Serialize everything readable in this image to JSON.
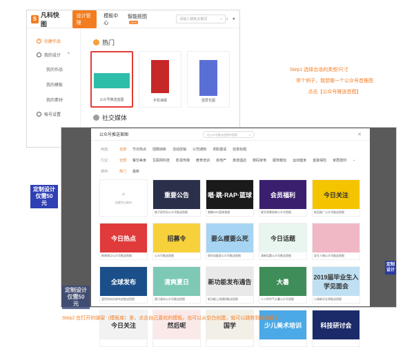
{
  "app": {
    "logo_text": "凡科快图",
    "nav": [
      "设计管理",
      "模板中心",
      "智能抠图"
    ],
    "nav_badge": "NEW",
    "search_placeholder": "请输入模板关键词"
  },
  "sidebar": {
    "create": "创建作品",
    "my_design": "我的设计",
    "items": [
      "我的作品",
      "我的模板",
      "我的素材"
    ],
    "account": "帐号设置"
  },
  "content": {
    "hot_title": "热门",
    "social_title": "社交媒体",
    "templates": [
      "公众号推送首图",
      "手机海报",
      "竖屏长图"
    ]
  },
  "step1": {
    "line1": "Step1 选择合适的类型/尺寸",
    "line2": "举个例子，我想做一个公众号首推图",
    "line3": "点击【公众号推送首图】"
  },
  "modal": {
    "title": "公众号推送首图",
    "search_placeholder": "在公众号推送首图中搜索",
    "filters": [
      {
        "label": "用途：",
        "options": [
          "全部",
          "节日热点",
          "招聘纳新",
          "活动促销",
          "公司通知",
          "求职邀请",
          "创意标题"
        ]
      },
      {
        "label": "行业：",
        "options": [
          "全部",
          "餐饮美食",
          "互联网科技",
          "影视传媒",
          "教育培训",
          "房地产",
          "旅游酒店",
          "数码家电",
          "服饰箱包",
          "运动健身",
          "金融保险",
          "家居建材"
        ]
      },
      {
        "label": "排序：",
        "options": [
          "热门",
          "最新"
        ]
      }
    ],
    "blank_label": "创建空白画布",
    "cards": [
      {
        "text": "重要公告",
        "cap": "橙子彩色风公众号推送首图",
        "bg": "#2a2f4a"
      },
      {
        "text": "唱·跳·RAP·篮球",
        "cap": "唱跳RAP篮球首图",
        "bg": "#1a1a1a"
      },
      {
        "text": "会员福利",
        "cap": "星空背景电商公众号首图",
        "bg": "#3a1f6e"
      },
      {
        "text": "今日关注",
        "cap": "新品推广公众号推送首图",
        "bg": "#f5c400"
      },
      {
        "text": "今日热点",
        "cap": "新闻热点公众号推送首图",
        "bg": "#e03a3a"
      },
      {
        "text": "招募令",
        "cap": "公众号推送首图",
        "bg": "#f7d13b"
      },
      {
        "text": "要么瘦要么死",
        "cap": "简约风瘦身公众号推送首图",
        "bg": "#a6d4f2"
      },
      {
        "text": "今日话题",
        "cap": "清新话题公众号推送首图",
        "bg": "#e9f6f0"
      },
      {
        "text": "",
        "cap": "女生人物公众号推送首图",
        "bg": "#f0b7c5"
      },
      {
        "text": "全球发布",
        "cap": "蓝色科技风发布会推送首图",
        "bg": "#1b4f8a"
      },
      {
        "text": "清爽夏日",
        "cap": "夏日清凉公众号推送首图",
        "bg": "#7ec9b6"
      },
      {
        "text": "新功能发布通告",
        "cap": "新功能上线通知推送首图",
        "bg": "#e9e9e9"
      },
      {
        "text": "大暑",
        "cap": "二十四节气大暑公众号首图",
        "bg": "#3f8d58"
      },
      {
        "text": "2019届毕业生入学见面会",
        "cap": "小清新毕业季推送首图",
        "bg": "#bfe0f2"
      },
      {
        "text": "今日关注",
        "cap": "",
        "bg": "#f2f2f2"
      },
      {
        "text": "然后呢",
        "cap": "",
        "bg": "#fbe9ea"
      },
      {
        "text": "国学",
        "cap": "",
        "bg": "#f2efe6"
      },
      {
        "text": "少儿美术培训",
        "cap": "",
        "bg": "#4aa9e6"
      },
      {
        "text": "科技研讨会",
        "cap": "",
        "bg": "#1b2b6a"
      }
    ]
  },
  "promo": {
    "text1": "定制设计",
    "text2": "仅需50元"
  },
  "step2": "Step2 在打开的弹窗（模板库）里，点击自己喜欢的模板。也可以从空白创建，就可以跳转到编辑器了。",
  "colors": {
    "accent": "#f47c20",
    "highlight": "#e53935"
  }
}
